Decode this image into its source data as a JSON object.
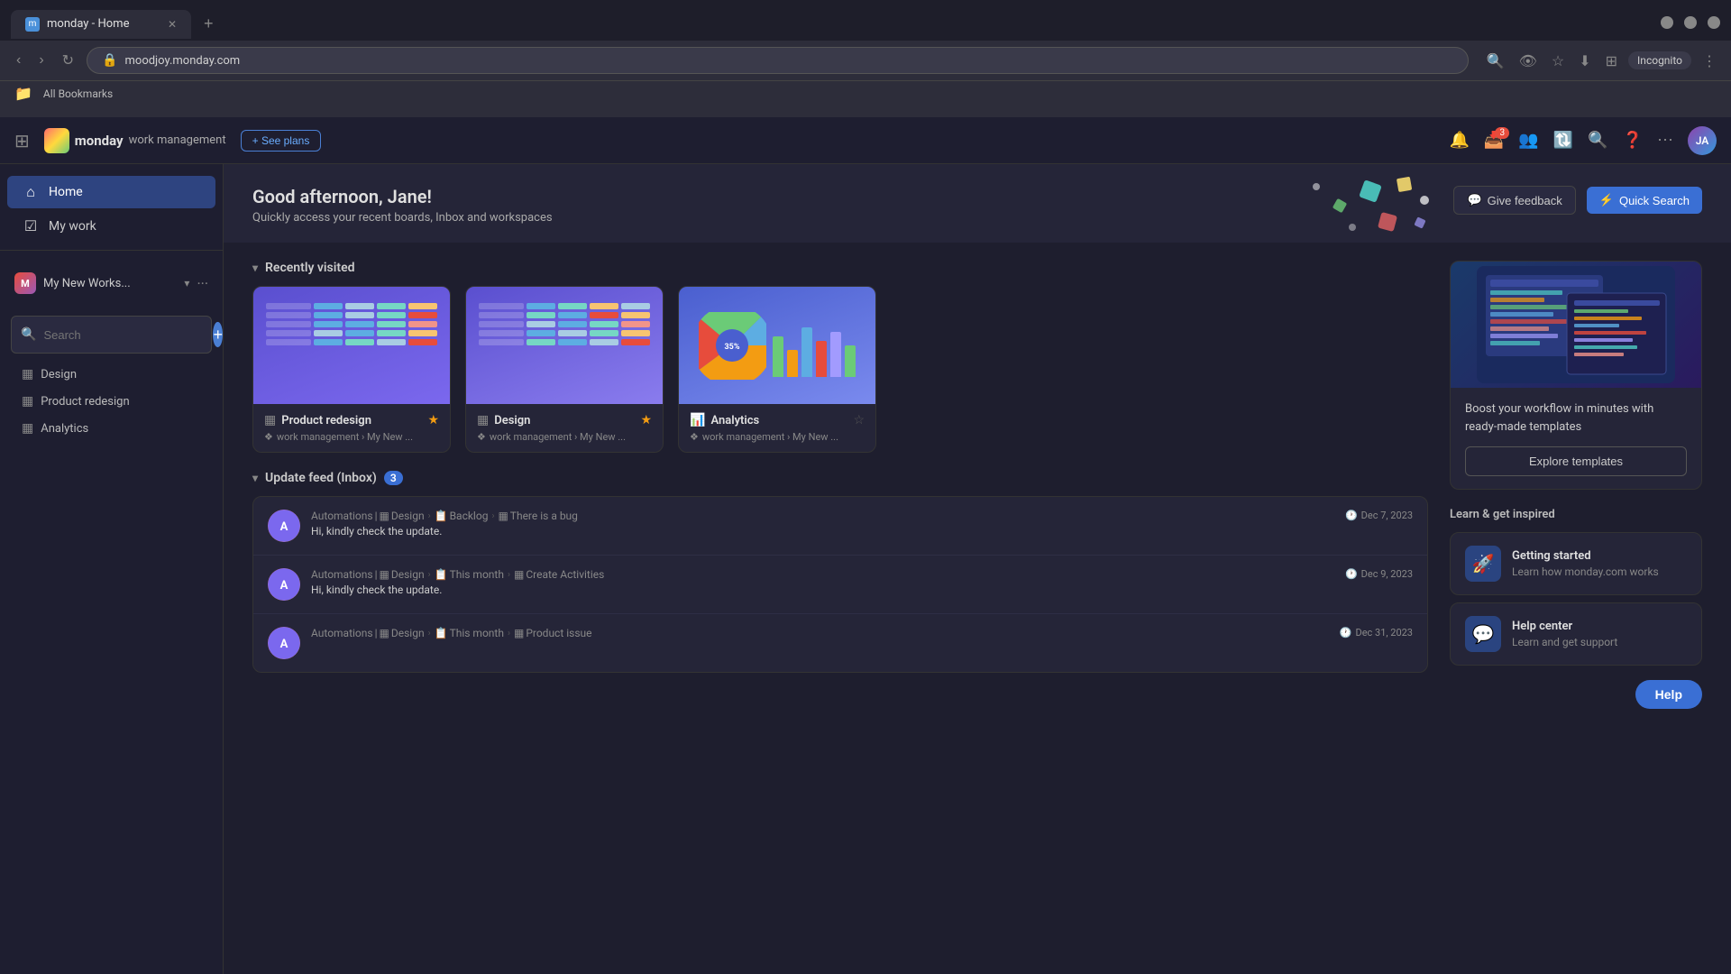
{
  "browser": {
    "tab_title": "monday - Home",
    "url": "moodjoy.monday.com",
    "new_tab_label": "+",
    "incognito_label": "Incognito",
    "bookmarks_label": "All Bookmarks"
  },
  "app": {
    "logo_text": "monday",
    "logo_sub": "work management",
    "see_plans_label": "+ See plans",
    "notification_count": "3"
  },
  "sidebar": {
    "home_label": "Home",
    "my_work_label": "My work",
    "workspace_name": "My New Works...",
    "search_placeholder": "Search",
    "boards": [
      {
        "name": "Design",
        "icon": "▦"
      },
      {
        "name": "Product redesign",
        "icon": "▦"
      },
      {
        "name": "Analytics",
        "icon": "▦"
      }
    ]
  },
  "header": {
    "greeting": "Good afternoon, Jane!",
    "subtitle": "Quickly access your recent boards, Inbox and workspaces",
    "feedback_label": "Give feedback",
    "quick_search_label": "Quick Search"
  },
  "recently_visited": {
    "section_title": "Recently visited",
    "cards": [
      {
        "title": "Product redesign",
        "meta": "work management › My New ...",
        "starred": true
      },
      {
        "title": "Design",
        "meta": "work management › My New ...",
        "starred": true
      },
      {
        "title": "Analytics",
        "meta": "work management › My New ...",
        "starred": false
      }
    ]
  },
  "update_feed": {
    "section_title": "Update feed (Inbox)",
    "badge_count": "3",
    "items": [
      {
        "sender": "Automations",
        "breadcrumb": "Design › Backlog › There is a bug",
        "message": "Hi, kindly check the update.",
        "time": "Dec 7, 2023"
      },
      {
        "sender": "Automations",
        "breadcrumb": "Design › This month › Create Activities",
        "message": "Hi, kindly check the update.",
        "time": "Dec 9, 2023"
      },
      {
        "sender": "Automations",
        "breadcrumb": "Design › This month › Product issue",
        "message": "",
        "time": "Dec 31, 2023"
      }
    ]
  },
  "right_panel": {
    "template_card": {
      "description": "Boost your workflow in minutes with ready-made templates",
      "explore_label": "Explore templates"
    },
    "inspire_section": {
      "title": "Learn & get inspired",
      "items": [
        {
          "title": "Getting started",
          "subtitle": "Learn how monday.com works",
          "icon": "🚀"
        },
        {
          "title": "Help center",
          "subtitle": "Learn and get support",
          "icon": "💬"
        }
      ]
    },
    "help_label": "Help"
  }
}
